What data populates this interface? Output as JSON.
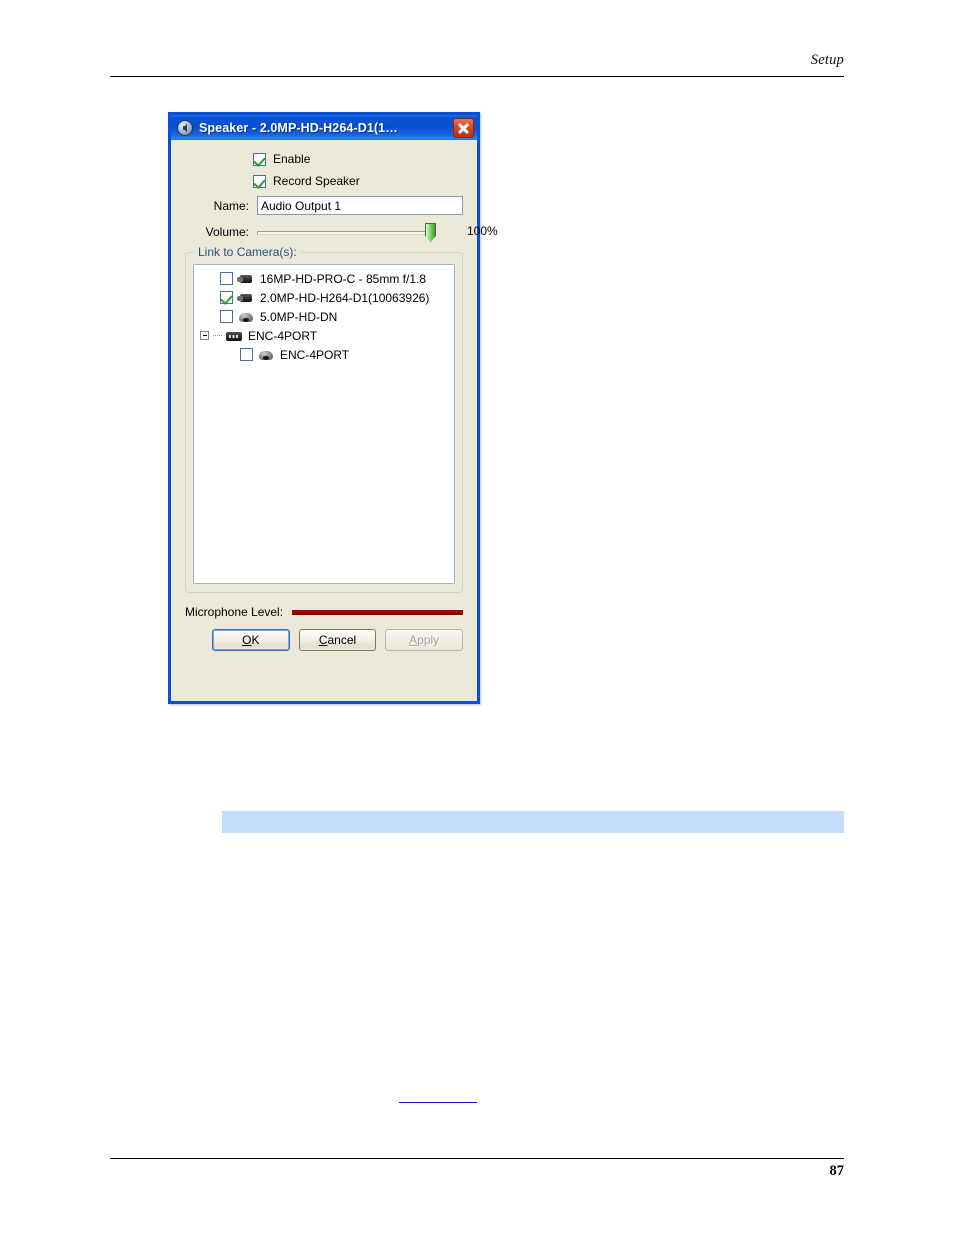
{
  "page": {
    "header_text": "Setup",
    "page_number": "87"
  },
  "dialog": {
    "title": "Speaker - 2.0MP-HD-H264-D1(1…",
    "title_icon": "speaker-icon",
    "close_icon": "close-icon",
    "enable": {
      "label": "Enable",
      "checked": true
    },
    "record_speaker": {
      "label": "Record Speaker",
      "checked": true
    },
    "name": {
      "label": "Name:",
      "value": "Audio Output 1",
      "placeholder": ""
    },
    "volume": {
      "label": "Volume:",
      "value": "100%",
      "percent": 100
    },
    "group": {
      "title": "Link to Camera(s):"
    },
    "tree": [
      {
        "label": "16MP-HD-PRO-C - 85mm f/1.8",
        "icon": "bullet-camera-icon",
        "checked": false,
        "level": 1,
        "expander": false
      },
      {
        "label": "2.0MP-HD-H264-D1(10063926)",
        "icon": "bullet-camera-icon",
        "checked": true,
        "level": 1,
        "expander": false
      },
      {
        "label": "5.0MP-HD-DN",
        "icon": "dome-camera-icon",
        "checked": false,
        "level": 1,
        "expander": false
      },
      {
        "label": "ENC-4PORT",
        "icon": "encoder-icon",
        "checked": null,
        "level": 0,
        "expander": true,
        "expander_state": "expanded"
      },
      {
        "label": "ENC-4PORT",
        "icon": "dome-camera-icon",
        "checked": false,
        "level": 2,
        "expander": false
      }
    ],
    "microphone": {
      "label": "Microphone Level:",
      "level_color": "#b40000"
    },
    "buttons": {
      "ok": "OK",
      "ok_accel": "O",
      "cancel": "Cancel",
      "cancel_accel": "C",
      "apply": "Apply",
      "apply_accel": "A",
      "apply_enabled": false
    }
  },
  "colors": {
    "titlebar": "#0a50d2",
    "dialog_bg": "#ece9d8",
    "highlight_bar": "#c6dcfb",
    "link": "#1414c8",
    "check": "#2f9b2f"
  }
}
